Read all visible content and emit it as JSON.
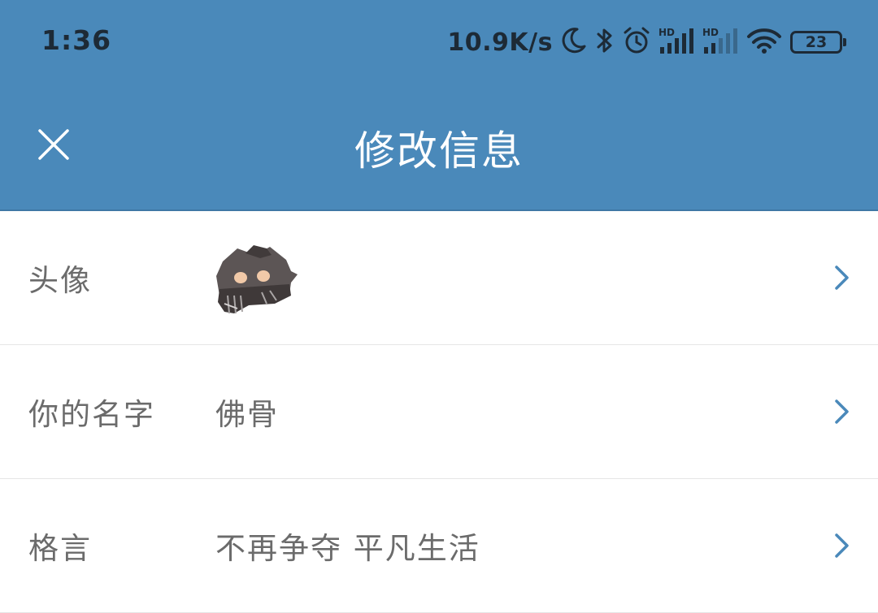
{
  "status_bar": {
    "time": "1:36",
    "net_speed": "10.9K/s",
    "battery": "23",
    "icons": [
      "moon-icon",
      "bluetooth-icon",
      "alarm-icon",
      "signal-hd-icon",
      "signal-hd-icon",
      "wifi-icon",
      "battery-icon"
    ],
    "signal_badge": "HD"
  },
  "header": {
    "title": "修改信息",
    "close_icon": "close-icon",
    "background": "#4a89ba"
  },
  "rows": [
    {
      "label": "头像",
      "value": "",
      "type": "avatar",
      "icon": "chevron-right-icon"
    },
    {
      "label": "你的名字",
      "value": "佛骨",
      "type": "text",
      "icon": "chevron-right-icon"
    },
    {
      "label": "格言",
      "value": "不再争夺 平凡生活",
      "type": "text",
      "icon": "chevron-right-icon"
    }
  ],
  "colors": {
    "accent": "#4a89ba",
    "chevron": "#4a89ba",
    "text_secondary": "#6b6b6b"
  }
}
